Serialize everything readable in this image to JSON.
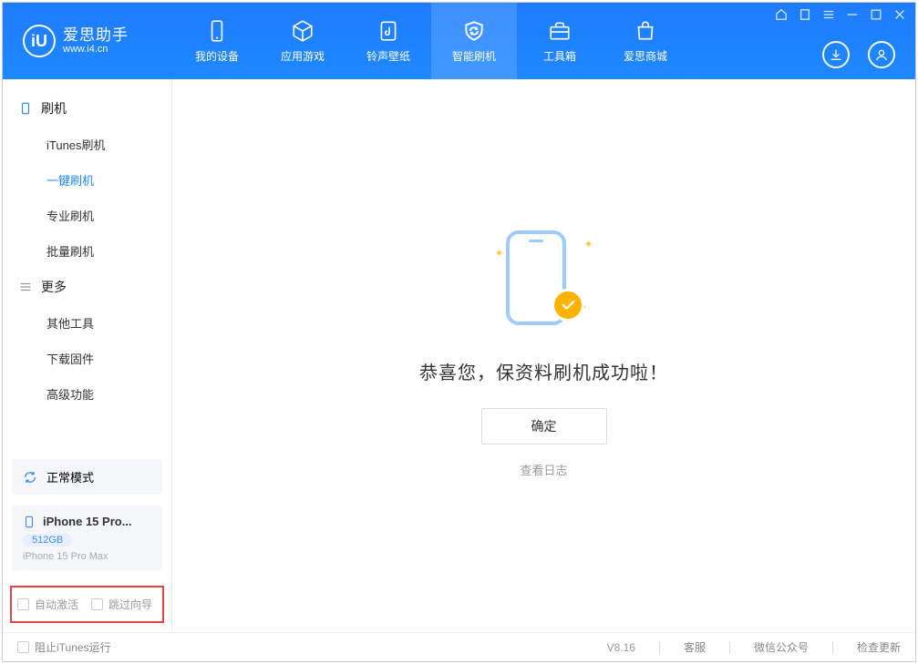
{
  "app": {
    "name": "爱思助手",
    "url": "www.i4.cn"
  },
  "nav": {
    "items": [
      {
        "label": "我的设备"
      },
      {
        "label": "应用游戏"
      },
      {
        "label": "铃声壁纸"
      },
      {
        "label": "智能刷机"
      },
      {
        "label": "工具箱"
      },
      {
        "label": "爱思商城"
      }
    ]
  },
  "sidebar": {
    "section_flash": {
      "title": "刷机",
      "items": [
        {
          "label": "iTunes刷机"
        },
        {
          "label": "一键刷机"
        },
        {
          "label": "专业刷机"
        },
        {
          "label": "批量刷机"
        }
      ]
    },
    "section_more": {
      "title": "更多",
      "items": [
        {
          "label": "其他工具"
        },
        {
          "label": "下载固件"
        },
        {
          "label": "高级功能"
        }
      ]
    }
  },
  "device": {
    "mode": "正常模式",
    "name": "iPhone 15 Pro...",
    "storage": "512GB",
    "full_name": "iPhone 15 Pro Max"
  },
  "highlight_options": {
    "auto_activate": "自动激活",
    "skip_wizard": "跳过向导"
  },
  "content": {
    "title": "恭喜您，保资料刷机成功啦！",
    "confirm": "确定",
    "view_log": "查看日志"
  },
  "footer": {
    "block_itunes": "阻止iTunes运行",
    "version": "V8.16",
    "support": "客服",
    "wechat": "微信公众号",
    "check_update": "检查更新"
  }
}
